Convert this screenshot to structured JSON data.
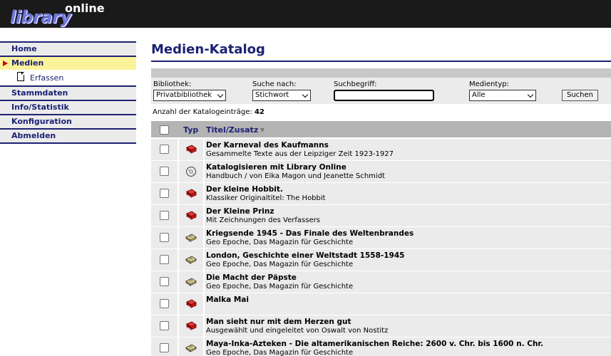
{
  "app": {
    "logo_main": "library",
    "logo_sub": "online"
  },
  "sidebar": {
    "items": [
      {
        "label": "Home",
        "active": false
      },
      {
        "label": "Medien",
        "active": true
      },
      {
        "label": "Erfassen",
        "sub": true
      },
      {
        "label": "Stammdaten",
        "active": false
      },
      {
        "label": "Info/Statistik",
        "active": false
      },
      {
        "label": "Konfiguration",
        "active": false
      },
      {
        "label": "Abmelden",
        "active": false
      }
    ]
  },
  "main": {
    "title": "Medien-Katalog",
    "search": {
      "library_label": "Bibliothek:",
      "library_value": "Privatbibliothek",
      "search_by_label": "Suche nach:",
      "search_by_value": "Stichwort",
      "term_label": "Suchbegriff:",
      "term_value": "",
      "media_type_label": "Medientyp:",
      "media_type_value": "Alle",
      "submit_label": "Suchen"
    },
    "count_label": "Anzahl der Katalogeinträge:",
    "count_value": "42",
    "table": {
      "col_type": "Typ",
      "col_title": "Titel/Zusatz",
      "rows": [
        {
          "icon": "book-icon",
          "title": "Der Karneval des Kaufmanns",
          "sub": "Gesammelte Texte aus der Leipziger Zeit 1923-1927"
        },
        {
          "icon": "cd-icon",
          "title": "Katalogisieren mit Library Online",
          "sub": "Handbuch / von Eika Magon und Jeanette Schmidt"
        },
        {
          "icon": "book-icon",
          "title": "Der kleine Hobbit.",
          "sub": "Klassiker Originaltitel: The Hobbit"
        },
        {
          "icon": "book-icon",
          "title": "Der Kleine Prinz",
          "sub": "Mit Zeichnungen des Verfassers"
        },
        {
          "icon": "magazine-icon",
          "title": "Kriegsende 1945 - Das Finale des Weltenbrandes",
          "sub": "Geo Epoche, Das Magazin für Geschichte"
        },
        {
          "icon": "magazine-icon",
          "title": "London, Geschichte einer Weltstadt 1558-1945",
          "sub": "Geo Epoche, Das Magazin für Geschichte"
        },
        {
          "icon": "magazine-icon",
          "title": "Die Macht der Päpste",
          "sub": "Geo Epoche, Das Magazin für Geschichte"
        },
        {
          "icon": "book-icon",
          "title": "Malka Mai",
          "sub": ""
        },
        {
          "icon": "book-icon",
          "title": "Man sieht nur mit dem Herzen gut",
          "sub": "Ausgewählt und eingeleitet von Oswalt von Nostitz"
        },
        {
          "icon": "magazine-icon",
          "title": "Maya-Inka-Azteken - Die altamerikanischen Reiche: 2600 v. Chr. bis 1600 n. Chr.",
          "sub": "Geo Epoche, Das Magazin für Geschichte"
        }
      ]
    }
  },
  "colors": {
    "accent": "#1c2273",
    "active_nav": "#faf39a",
    "book_red": "#c00000",
    "header_bg": "#1a1a1a"
  }
}
